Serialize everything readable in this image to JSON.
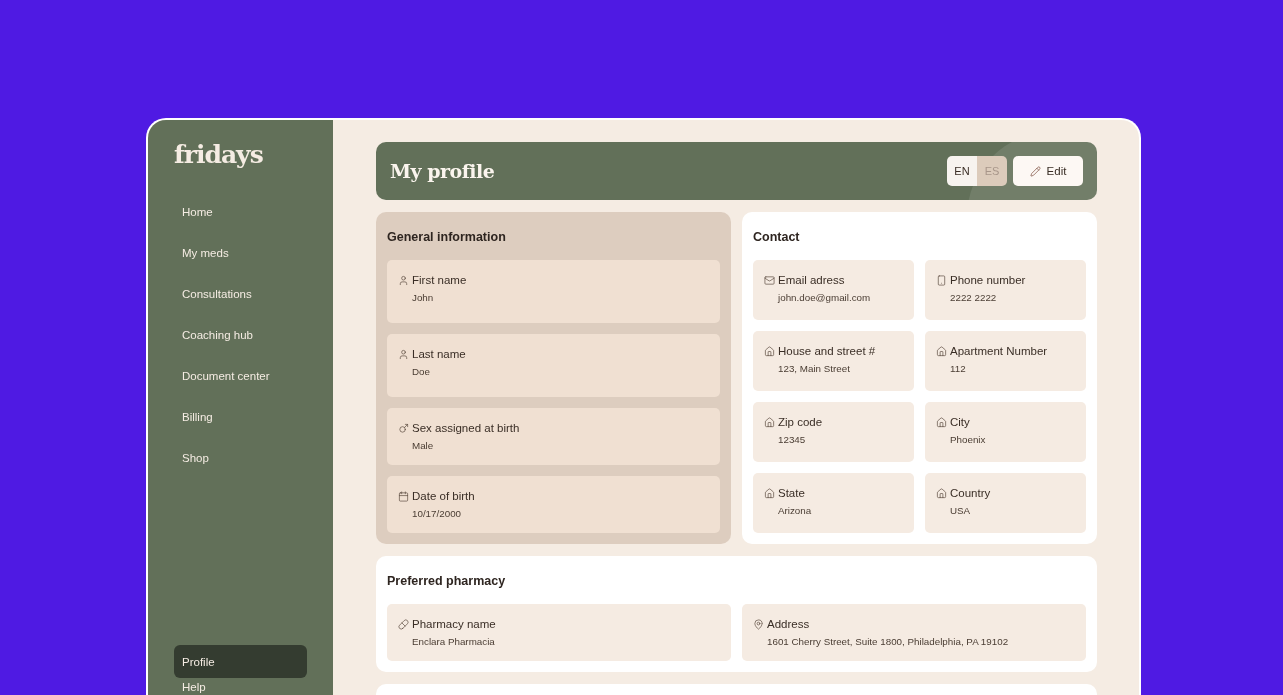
{
  "sidebar": {
    "logo": "fridays",
    "items": [
      {
        "label": "Home",
        "selected": false
      },
      {
        "label": "My meds",
        "selected": false
      },
      {
        "label": "Consultations",
        "selected": false
      },
      {
        "label": "Coaching hub",
        "selected": false
      },
      {
        "label": "Document center",
        "selected": false
      },
      {
        "label": "Billing",
        "selected": false
      },
      {
        "label": "Shop",
        "selected": false
      }
    ],
    "bottom_items": [
      {
        "label": "Profile",
        "selected": true
      },
      {
        "label": "Help",
        "selected": false
      }
    ]
  },
  "header": {
    "title": "My profile",
    "languages": [
      {
        "label": "EN",
        "selected": true
      },
      {
        "label": "ES",
        "selected": false
      }
    ],
    "edit_button": "Edit"
  },
  "general_information": {
    "title": "General information",
    "fields": [
      {
        "kind": "person",
        "label": "First name",
        "value": "John"
      },
      {
        "kind": "person",
        "label": "Last name",
        "value": "Doe"
      },
      {
        "kind": "male",
        "label": "Sex assigned at birth",
        "value": "Male"
      },
      {
        "kind": "calendar",
        "label": "Date of birth",
        "value": "10/17/2000"
      }
    ]
  },
  "contact": {
    "title": "Contact",
    "fields": [
      {
        "kind": "email",
        "label": "Email adress",
        "value": "john.doe@gmail.com"
      },
      {
        "kind": "phone",
        "label": "Phone number",
        "value": "2222 2222"
      },
      {
        "kind": "address",
        "label": "House and street #",
        "value": "123, Main Street"
      },
      {
        "kind": "address",
        "label": "Apartment Number",
        "value": "112"
      },
      {
        "kind": "address",
        "label": "Zip code",
        "value": "12345"
      },
      {
        "kind": "address",
        "label": "City",
        "value": "Phoenix"
      },
      {
        "kind": "address",
        "label": "State",
        "value": "Arizona"
      },
      {
        "kind": "address",
        "label": "Country",
        "value": "USA"
      }
    ]
  },
  "preferred_pharmacy": {
    "title": "Preferred pharmacy",
    "fields": [
      {
        "kind": "pharmacy",
        "label": "Pharmacy name",
        "value": "Enclara Pharmacia"
      },
      {
        "kind": "location",
        "label": "Address",
        "value": "1601 Cherry Street, Suite 1800, Philadelphia, PA 19102"
      }
    ]
  }
}
